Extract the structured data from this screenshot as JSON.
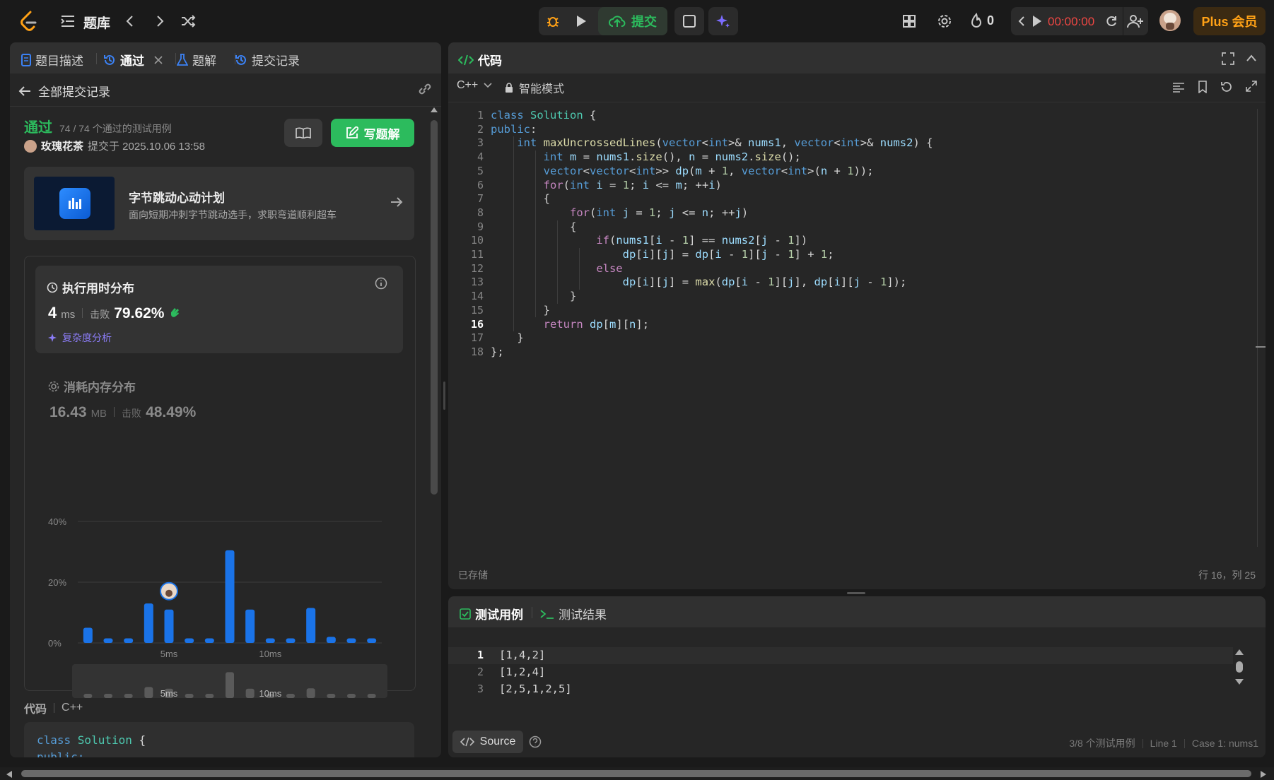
{
  "topbar": {
    "title": "题库",
    "submit_label": "提交",
    "streak": "0",
    "timer": "00:00:00",
    "plus_label": "Plus 会员"
  },
  "left": {
    "tabs": [
      {
        "label": "题目描述"
      },
      {
        "label": "通过"
      },
      {
        "label": "题解"
      },
      {
        "label": "提交记录"
      }
    ],
    "back_label": "全部提交记录",
    "status": "通过",
    "testcases": "74 / 74 个通过的测试用例",
    "user": "玫瑰花茶",
    "submitted_at": "提交于 2025.10.06 13:58",
    "write_solution": "写题解",
    "promo": {
      "title": "字节跳动心动计划",
      "subtitle": "面向短期冲刺字节跳动选手，求职弯道顺利超车"
    },
    "runtime": {
      "title": "执行用时分布",
      "value": "4",
      "unit": "ms",
      "beats_label": "击败",
      "beats": "79.62%",
      "complexity_label": "复杂度分析"
    },
    "memory": {
      "title": "消耗内存分布",
      "value": "16.43",
      "unit": "MB",
      "beats_label": "击败",
      "beats": "48.49%"
    },
    "code_label": "代码",
    "code_lang": "C++",
    "code_preview": [
      "class Solution {",
      "public:"
    ]
  },
  "chart_data": {
    "type": "bar",
    "x_tick_labels": [
      "5ms",
      "10ms"
    ],
    "y_tick_labels": [
      "0%",
      "20%",
      "40%"
    ],
    "ylim": [
      0,
      40
    ],
    "values": [
      5,
      1.5,
      1.5,
      13,
      11,
      1.5,
      1.5,
      30.5,
      11,
      1.5,
      1.5,
      11.5,
      2,
      1.5,
      1.5
    ],
    "highlight_index": 4,
    "colors": {
      "bar": "#1a73e8",
      "grid": "#3c3c3c"
    }
  },
  "editor": {
    "title": "代码",
    "language": "C++",
    "mode": "智能模式",
    "saved_label": "已存储",
    "cursor": "行 16，列 25",
    "lines": [
      "class Solution {",
      "public:",
      "    int maxUncrossedLines(vector<int>& nums1, vector<int>& nums2) {",
      "        int m = nums1.size(), n = nums2.size();",
      "        vector<vector<int>> dp(m + 1, vector<int>(n + 1));",
      "        for(int i = 1; i <= m; ++i)",
      "        {",
      "            for(int j = 1; j <= n; ++j)",
      "            {",
      "                if(nums1[i - 1] == nums2[j - 1])",
      "                    dp[i][j] = dp[i - 1][j - 1] + 1;",
      "                else",
      "                    dp[i][j] = max(dp[i - 1][j], dp[i][j - 1]);",
      "            }",
      "        }",
      "        return dp[m][n];",
      "    }",
      "};"
    ],
    "current_line": 16
  },
  "testpanel": {
    "tab_cases": "测试用例",
    "tab_results": "测试结果",
    "lines": [
      "[1,4,2]",
      "[1,2,4]",
      "[2,5,1,2,5]"
    ],
    "source_label": "Source",
    "status": [
      "3/8 个测试用例",
      "Line 1",
      "Case 1: nums1"
    ]
  }
}
